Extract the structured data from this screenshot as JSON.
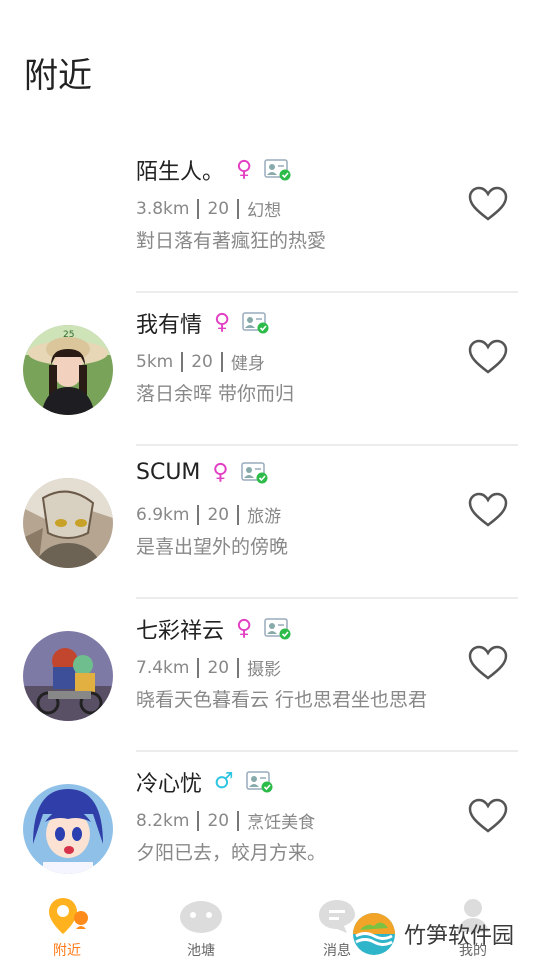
{
  "page_title": "附近",
  "users": [
    {
      "name": "陌生人。",
      "gender_symbol": "♀",
      "gender_color": "#e23fc3",
      "distance": "3.8km",
      "age": "20",
      "interest": "幻想",
      "bio": "對日落有著瘋狂的热愛",
      "avatar": "none"
    },
    {
      "name": "我有情",
      "gender_symbol": "♀",
      "gender_color": "#e23fc3",
      "distance": "5km",
      "age": "20",
      "interest": "健身",
      "bio": "落日余晖 带你而归",
      "avatar": "girl-hat"
    },
    {
      "name": "SCUM",
      "gender_symbol": "♀",
      "gender_color": "#e23fc3",
      "distance": "6.9km",
      "age": "20",
      "interest": "旅游",
      "bio": "是喜出望外的傍晚",
      "avatar": "anime-mask"
    },
    {
      "name": "七彩祥云",
      "gender_symbol": "♀",
      "gender_color": "#e23fc3",
      "distance": "7.4km",
      "age": "20",
      "interest": "摄影",
      "bio": "晓看天色暮看云 行也思君坐也思君",
      "avatar": "anime-motorbike"
    },
    {
      "name": "冷心忧",
      "gender_symbol": "♂",
      "gender_color": "#2ec5e0",
      "distance": "8.2km",
      "age": "20",
      "interest": "烹饪美食",
      "bio": "夕阳已去，皎月方来。",
      "avatar": "anime-bluehair"
    }
  ],
  "tabs": [
    {
      "label": "附近",
      "icon": "location-pin-icon",
      "active": true
    },
    {
      "label": "池塘",
      "icon": "pond-icon",
      "active": false
    },
    {
      "label": "消息",
      "icon": "message-icon",
      "active": false
    },
    {
      "label": "我的",
      "icon": "profile-icon",
      "active": false
    }
  ],
  "watermark": {
    "text": "竹笋软件园"
  },
  "colors": {
    "accent": "#ff7a18",
    "female": "#e23fc3",
    "male": "#2ec5e0",
    "verify": "#2dbb4a"
  }
}
